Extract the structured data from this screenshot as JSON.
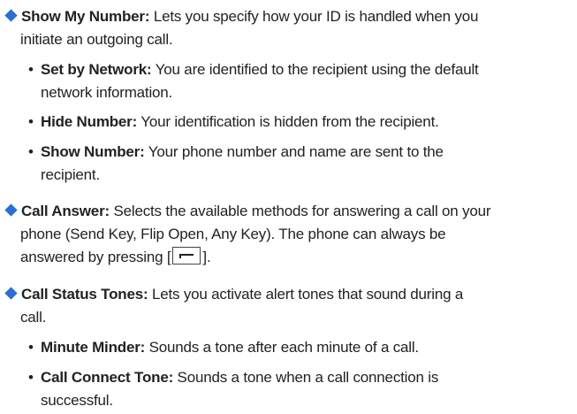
{
  "sections": [
    {
      "title": "Show My Number:",
      "text": " Lets you specify how your ID is handled when you",
      "text2": "initiate an outgoing call.",
      "subitems": [
        {
          "title": "Set by Network:",
          "text": " You are identified to the recipient using the default",
          "text2": "network information."
        },
        {
          "title": "Hide Number:",
          "text": " Your identification is hidden from the recipient."
        },
        {
          "title": "Show Number:",
          "text": " Your phone number and name are sent to the",
          "text2": "recipient."
        }
      ]
    },
    {
      "title": "Call Answer:",
      "text": " Selects the available methods for answering a call on your",
      "text2": "phone (Send Key, Flip Open, Any Key). The phone can always be",
      "text3a": "answered by pressing [",
      "text3b": "].",
      "key_icon": "send-key-icon"
    },
    {
      "title": "Call Status Tones:",
      "text": " Lets you activate alert tones that sound during a",
      "text2": "call.",
      "subitems": [
        {
          "title": "Minute Minder:",
          "text": " Sounds a tone after each minute of a call."
        },
        {
          "title": "Call Connect Tone:",
          "text": " Sounds a tone when a call connection is",
          "text2": "successful."
        }
      ]
    }
  ],
  "bullet_icon": "diamond-icon",
  "sub_bullet": "•",
  "colors": {
    "accent": "#2a6fd6",
    "text": "#222222"
  }
}
